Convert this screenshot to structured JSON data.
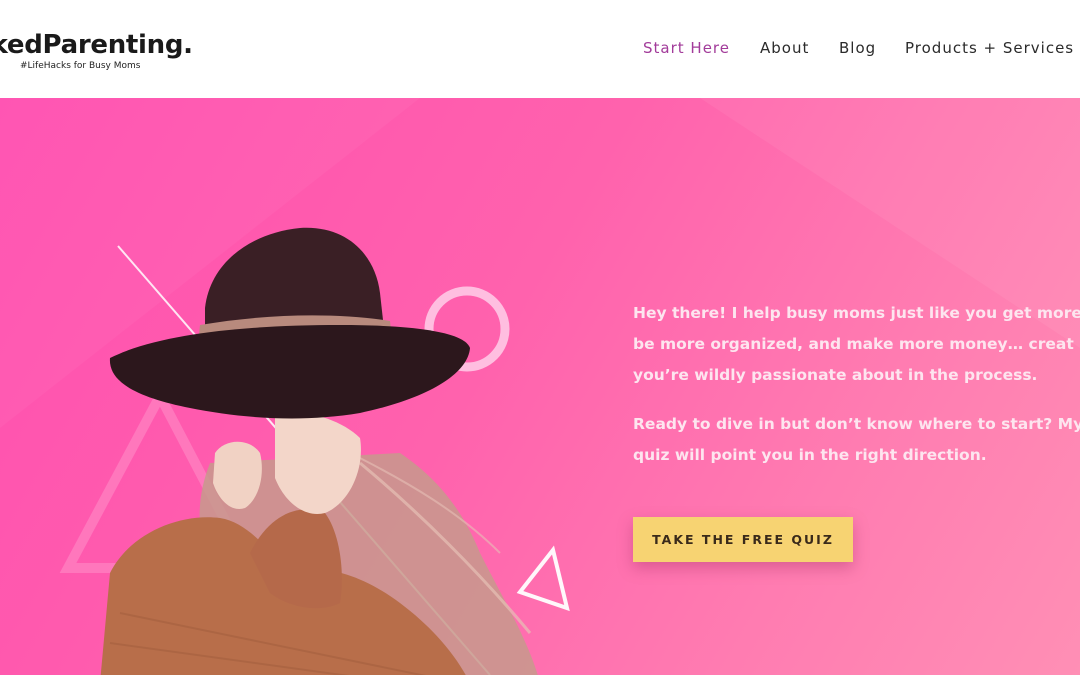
{
  "header": {
    "logo_name": "ikedParenting.",
    "logo_tagline": "#LifeHacks for Busy Moms",
    "nav": [
      {
        "label": "Start Here",
        "active": true
      },
      {
        "label": "About",
        "active": false
      },
      {
        "label": "Blog",
        "active": false
      },
      {
        "label": "Products + Services",
        "active": false
      }
    ]
  },
  "hero": {
    "paragraph_1": "Hey there! I help busy moms just like you get more\nbe more organized, and make more money… creat\nyou’re wildly passionate about in the process.",
    "paragraph_2": "Ready to dive in but don’t know where to start? My\nquiz will point you in the right direction.",
    "cta_label": "TAKE THE FREE QUIZ",
    "photo_subject": "woman-in-wide-brim-hat"
  },
  "colors": {
    "accent_nav": "#a23b9a",
    "hero_pink": "#ff5fae",
    "cta_yellow": "#f7d372"
  }
}
